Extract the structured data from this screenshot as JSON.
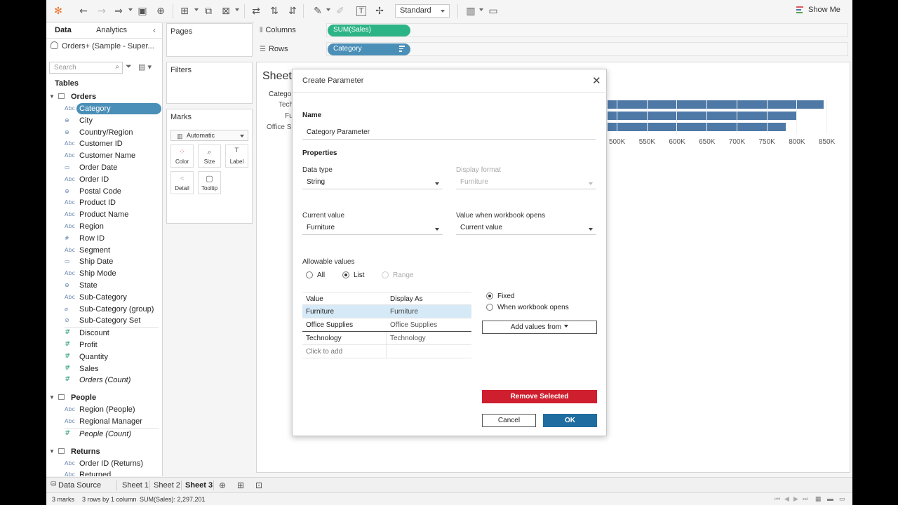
{
  "toolbar": {
    "fit": "Standard",
    "show_me": "Show Me"
  },
  "data_pane": {
    "tabs": [
      "Data",
      "Analytics"
    ],
    "datasource": "Orders+ (Sample - Super...",
    "search_placeholder": "Search",
    "tables_label": "Tables",
    "groups": [
      {
        "name": "Orders",
        "dimensions": [
          {
            "name": "Category",
            "type": "Abc",
            "selected": true
          },
          {
            "name": "City",
            "type": "geo"
          },
          {
            "name": "Country/Region",
            "type": "geo"
          },
          {
            "name": "Customer ID",
            "type": "Abc"
          },
          {
            "name": "Customer Name",
            "type": "Abc"
          },
          {
            "name": "Order Date",
            "type": "date"
          },
          {
            "name": "Order ID",
            "type": "Abc"
          },
          {
            "name": "Postal Code",
            "type": "geo"
          },
          {
            "name": "Product ID",
            "type": "Abc"
          },
          {
            "name": "Product Name",
            "type": "Abc"
          },
          {
            "name": "Region",
            "type": "Abc"
          },
          {
            "name": "Row ID",
            "type": "#"
          },
          {
            "name": "Segment",
            "type": "Abc"
          },
          {
            "name": "Ship Date",
            "type": "date"
          },
          {
            "name": "Ship Mode",
            "type": "Abc"
          },
          {
            "name": "State",
            "type": "geo"
          },
          {
            "name": "Sub-Category",
            "type": "Abc"
          },
          {
            "name": "Sub-Category (group)",
            "type": "group"
          },
          {
            "name": "Sub-Category Set",
            "type": "set"
          }
        ],
        "measures": [
          {
            "name": "Discount"
          },
          {
            "name": "Profit"
          },
          {
            "name": "Quantity"
          },
          {
            "name": "Sales"
          },
          {
            "name": "Orders (Count)",
            "italic": true
          }
        ]
      },
      {
        "name": "People",
        "dimensions": [
          {
            "name": "Region (People)",
            "type": "Abc"
          },
          {
            "name": "Regional Manager",
            "type": "Abc"
          }
        ],
        "measures": [
          {
            "name": "People (Count)",
            "italic": true
          }
        ]
      },
      {
        "name": "Returns",
        "dimensions": [
          {
            "name": "Order ID (Returns)",
            "type": "Abc"
          },
          {
            "name": "Returned",
            "type": "Abc"
          }
        ],
        "measures": []
      }
    ]
  },
  "cards": {
    "pages": "Pages",
    "filters": "Filters",
    "marks": "Marks",
    "mark_type": "Automatic",
    "mark_buttons": [
      "Color",
      "Size",
      "Label",
      "Detail",
      "Tooltip"
    ]
  },
  "shelves": {
    "columns_label": "Columns",
    "rows_label": "Rows",
    "columns_pill": "SUM(Sales)",
    "rows_pill": "Category"
  },
  "viz": {
    "sheet_title": "Sheet",
    "header": "Catego",
    "row_labels": [
      "Tech",
      "Fu",
      "Office S"
    ],
    "bar_fraction_of_axis": [
      0.975,
      0.855,
      0.805
    ],
    "ticks": [
      "500K",
      "550K",
      "600K",
      "650K",
      "700K",
      "750K",
      "800K",
      "850K"
    ]
  },
  "dialog": {
    "title": "Create Parameter",
    "name_label": "Name",
    "name_value": "Category Parameter",
    "properties_label": "Properties",
    "data_type_label": "Data type",
    "data_type_value": "String",
    "display_format_label": "Display format",
    "display_format_value": "Furniture",
    "current_value_label": "Current value",
    "current_value_value": "Furniture",
    "when_opens_label": "Value when workbook opens",
    "when_opens_value": "Current value",
    "allowable_label": "Allowable values",
    "allowable_options": [
      "All",
      "List",
      "Range"
    ],
    "table_headers": [
      "Value",
      "Display As"
    ],
    "table_rows": [
      {
        "value": "Furniture",
        "display": "Furniture"
      },
      {
        "value": "Office Supplies",
        "display": "Office Supplies"
      },
      {
        "value": "Technology",
        "display": "Technology"
      }
    ],
    "click_to_add": "Click to add",
    "fixed_label": "Fixed",
    "when_opens_radio": "When workbook opens",
    "add_values_from": "Add values from",
    "remove_selected": "Remove Selected",
    "cancel": "Cancel",
    "ok": "OK"
  },
  "sheet_tabs": {
    "data_source": "Data Source",
    "tabs": [
      "Sheet 1",
      "Sheet 2",
      "Sheet 3"
    ]
  },
  "status": {
    "marks": "3 marks",
    "rows_cols": "3 rows by 1 column",
    "sum": "SUM(Sales): 2,297,201"
  },
  "colors": {
    "pill_green": "#2db486",
    "pill_blue": "#4a8fb7",
    "bar": "#4e79a7",
    "remove_red": "#cf1f2e",
    "ok_blue": "#1f6ca1"
  }
}
